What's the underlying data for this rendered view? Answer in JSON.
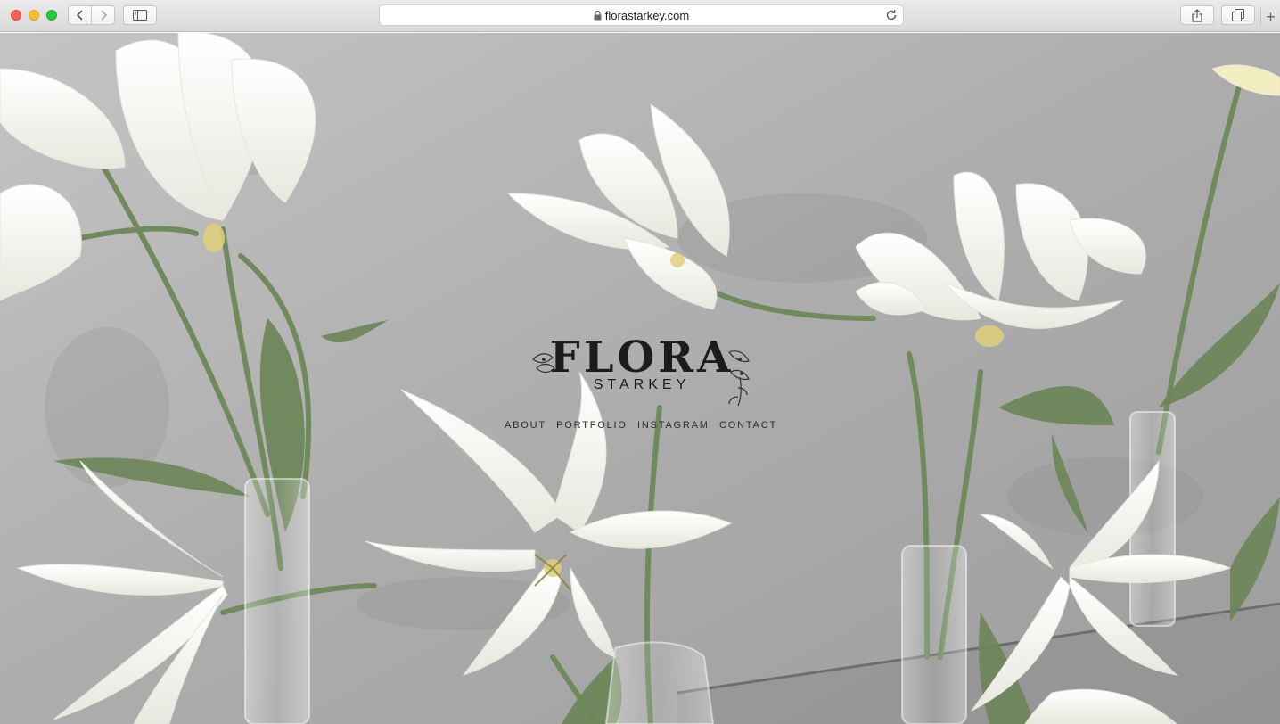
{
  "browser": {
    "url": "florastarkey.com",
    "icons": {
      "back": "chevron-left-icon",
      "forward": "chevron-right-icon",
      "sidebar": "sidebar-icon",
      "lock": "lock-icon",
      "reload": "reload-icon",
      "share": "share-icon",
      "tabs": "tabs-icon",
      "new_tab": "plus-icon"
    }
  },
  "site": {
    "brand": {
      "name": "FLORA",
      "tagline": "STARKEY"
    },
    "nav": [
      {
        "label": "ABOUT"
      },
      {
        "label": "PORTFOLIO"
      },
      {
        "label": "INSTAGRAM"
      },
      {
        "label": "CONTACT"
      }
    ]
  },
  "colors": {
    "background_wall": "#b3b3b3",
    "text": "#1c1c1c",
    "petal": "#f7f7f2",
    "stem": "#6f8a5c"
  }
}
